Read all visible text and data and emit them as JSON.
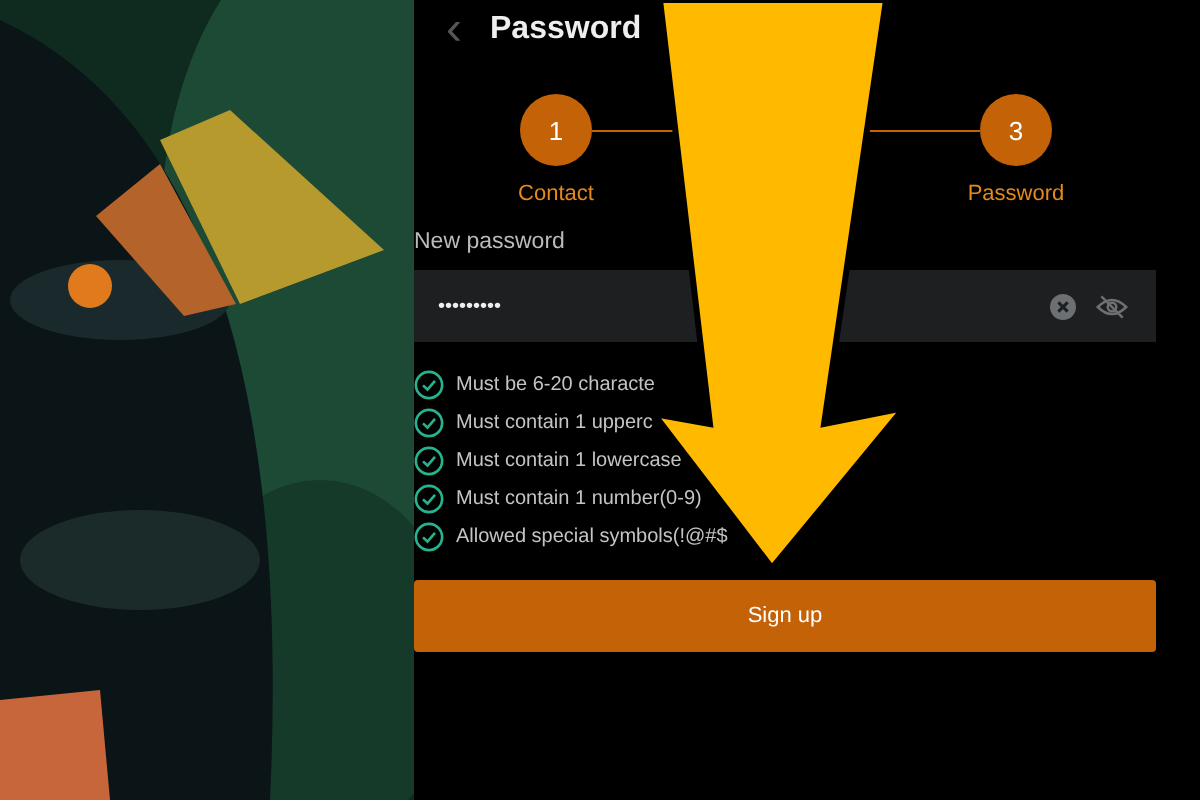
{
  "header": {
    "back": "‹",
    "title": "Password"
  },
  "steps": [
    {
      "number": "1",
      "label": "Contact"
    },
    {
      "number": "3",
      "label": "Password"
    }
  ],
  "field": {
    "label": "New password",
    "value": "•••••••••"
  },
  "rules": [
    {
      "text": "Must be 6-20 characte",
      "met": true
    },
    {
      "text": "Must contain 1 upperc",
      "met": true
    },
    {
      "text": "Must contain 1 lowercase",
      "met": true
    },
    {
      "text": "Must contain 1 number(0-9)",
      "met": true
    },
    {
      "text": "Allowed special symbols(!@#$",
      "met": true
    }
  ],
  "button": "Sign up"
}
